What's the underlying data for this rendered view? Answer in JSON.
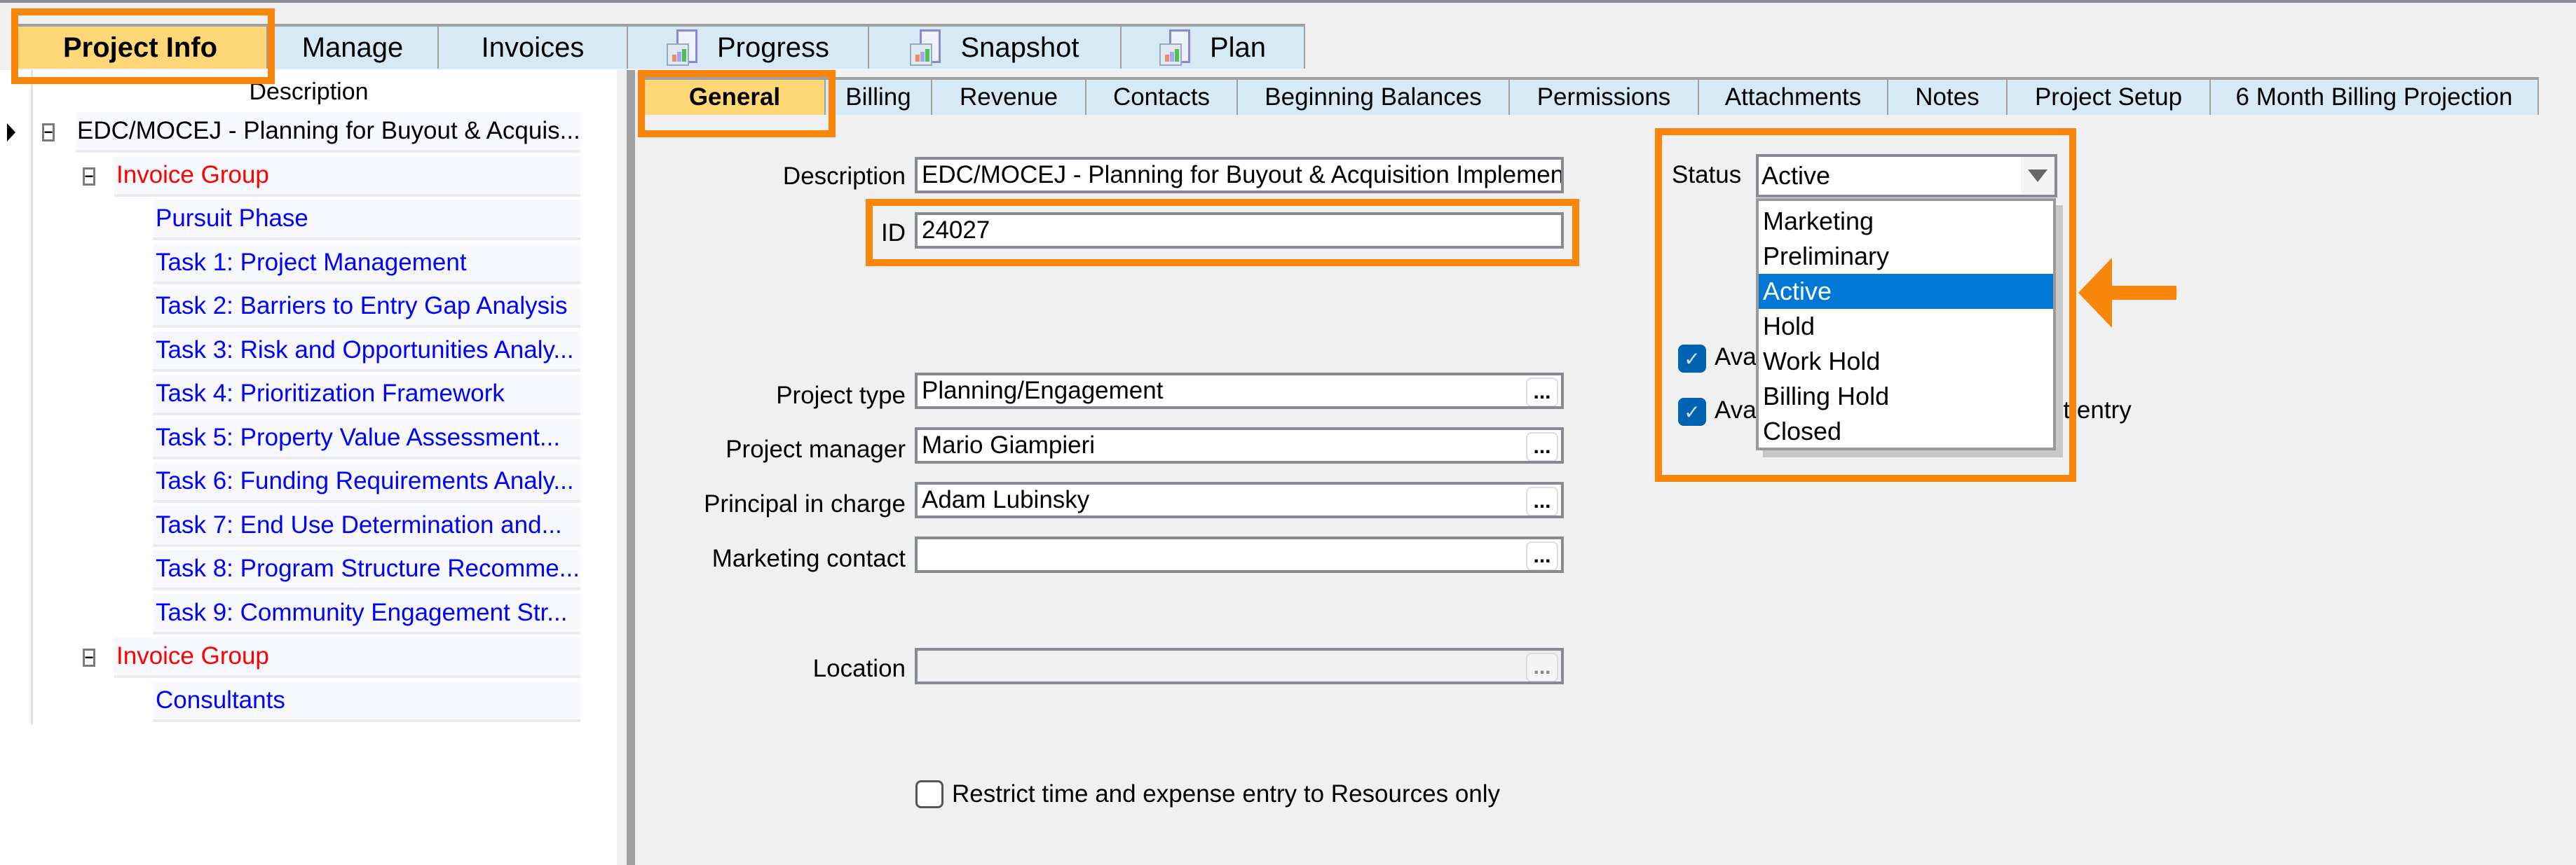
{
  "main_tabs": [
    {
      "label": "Project Info",
      "active": true,
      "icon": null
    },
    {
      "label": "Manage",
      "active": false,
      "icon": null
    },
    {
      "label": "Invoices",
      "active": false,
      "icon": null
    },
    {
      "label": "Progress",
      "active": false,
      "icon": "report-icon"
    },
    {
      "label": "Snapshot",
      "active": false,
      "icon": "report-icon"
    },
    {
      "label": "Plan",
      "active": false,
      "icon": "report-icon"
    }
  ],
  "tree": {
    "column_header": "Description",
    "rows": [
      {
        "level": 0,
        "type": "project",
        "label": "EDC/MOCEJ - Planning for Buyout & Acquis...",
        "expanded": true,
        "current": true
      },
      {
        "level": 1,
        "type": "group",
        "label": "Invoice Group",
        "expanded": true
      },
      {
        "level": 2,
        "type": "task",
        "label": "Pursuit Phase"
      },
      {
        "level": 2,
        "type": "task",
        "label": "Task 1: Project Management"
      },
      {
        "level": 2,
        "type": "task",
        "label": "Task 2: Barriers to Entry Gap Analysis"
      },
      {
        "level": 2,
        "type": "task",
        "label": "Task 3: Risk and Opportunities Analy..."
      },
      {
        "level": 2,
        "type": "task",
        "label": "Task 4: Prioritization Framework"
      },
      {
        "level": 2,
        "type": "task",
        "label": "Task 5: Property Value Assessment..."
      },
      {
        "level": 2,
        "type": "task",
        "label": "Task 6: Funding Requirements Analy..."
      },
      {
        "level": 2,
        "type": "task",
        "label": "Task 7: End Use Determination and..."
      },
      {
        "level": 2,
        "type": "task",
        "label": "Task 8: Program Structure Recomme..."
      },
      {
        "level": 2,
        "type": "task",
        "label": "Task 9: Community Engagement Str..."
      },
      {
        "level": 1,
        "type": "group",
        "label": "Invoice Group",
        "expanded": true
      },
      {
        "level": 2,
        "type": "task",
        "label": "Consultants"
      }
    ]
  },
  "sub_tabs": [
    {
      "label": "General",
      "active": true
    },
    {
      "label": "Billing",
      "active": false
    },
    {
      "label": "Revenue",
      "active": false
    },
    {
      "label": "Contacts",
      "active": false
    },
    {
      "label": "Beginning Balances",
      "active": false
    },
    {
      "label": "Permissions",
      "active": false
    },
    {
      "label": "Attachments",
      "active": false
    },
    {
      "label": "Notes",
      "active": false
    },
    {
      "label": "Project Setup",
      "active": false
    },
    {
      "label": "6 Month Billing Projection",
      "active": false
    }
  ],
  "form": {
    "description": {
      "label": "Description",
      "value": "EDC/MOCEJ - Planning for Buyout & Acquisition Implementati"
    },
    "id": {
      "label": "ID",
      "value": "24027"
    },
    "project_type": {
      "label": "Project type",
      "value": "Planning/Engagement"
    },
    "project_manager": {
      "label": "Project manager",
      "value": "Mario Giampieri"
    },
    "principal_in_charge": {
      "label": "Principal in charge",
      "value": "Adam Lubinsky"
    },
    "marketing_contact": {
      "label": "Marketing contact",
      "value": ""
    },
    "location": {
      "label": "Location",
      "value": ""
    },
    "ellipsis": "...",
    "restrict_checkbox": {
      "label": "Restrict time and expense entry to Resources only",
      "checked": false
    }
  },
  "status": {
    "label": "Status",
    "value": "Active",
    "options": [
      "Marketing",
      "Preliminary",
      "Active",
      "Hold",
      "Work Hold",
      "Billing Hold",
      "Closed"
    ],
    "selected_index": 2,
    "checkbox1": {
      "label_visible": "Ava",
      "checked": true
    },
    "checkbox2": {
      "label_visible": "Ava",
      "label_tail_visible": "nt entry",
      "checked": true
    }
  },
  "annotation_color": "#f7860b",
  "check_glyph": "✓",
  "expander_glyph": "−"
}
